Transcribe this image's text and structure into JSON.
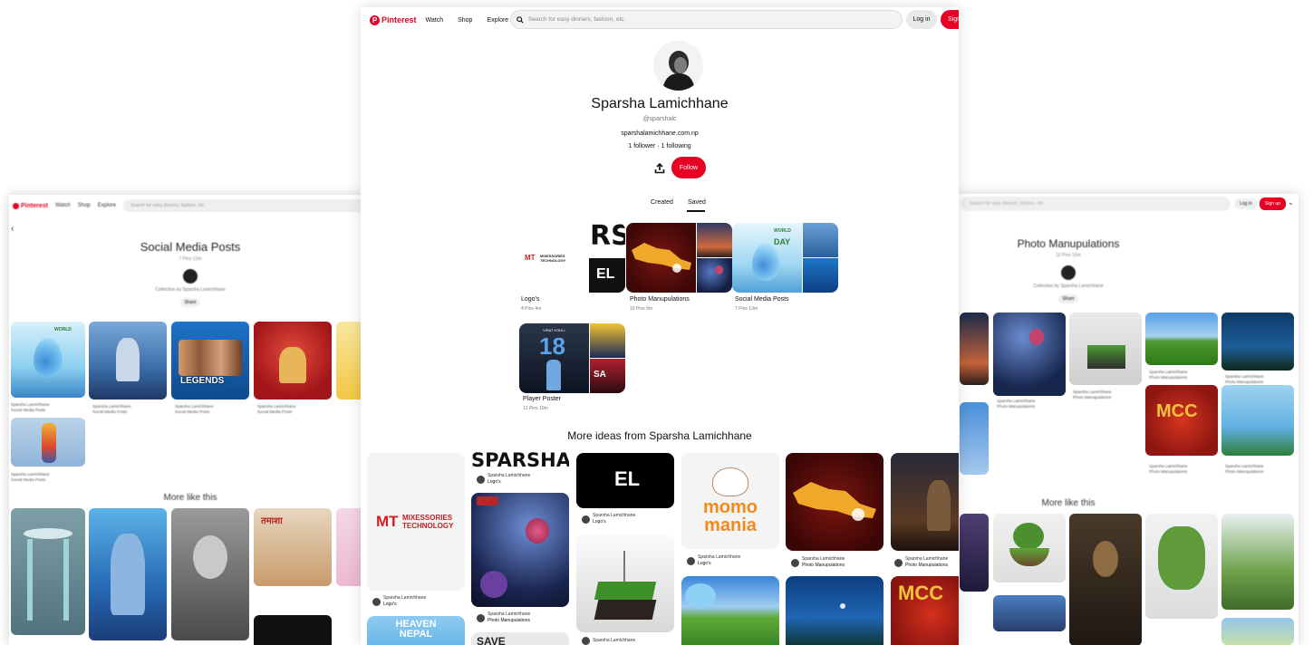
{
  "colors": {
    "brand_red": "#e60023",
    "text": "#111111",
    "muted": "#767676"
  },
  "nav": {
    "logo": "Pinterest",
    "links": [
      "Watch",
      "Shop",
      "Explore"
    ],
    "search_placeholder": "Search for easy dinners, fashion, etc.",
    "login": "Log in",
    "signup": "Sign up",
    "signup_visible": "Sign"
  },
  "profile": {
    "name": "Sparsha Lamichhane",
    "handle": "@sparshalc",
    "website": "sparshalamichhane.com.np",
    "stats": "1 follower · 1 following",
    "follow_label": "Follow",
    "share_icon": "share-upload-icon"
  },
  "tabs": {
    "created": "Created",
    "saved": "Saved",
    "active": "Saved"
  },
  "boards": [
    {
      "name": "Logo's",
      "meta": "4 Pins  4m"
    },
    {
      "name": "Photo Manupulations",
      "meta": "10 Pins  9m"
    },
    {
      "name": "Social Media Posts",
      "meta": "7 Pins  13m"
    },
    {
      "name": "Player Poster",
      "meta": "13 Pins  19m"
    }
  ],
  "board_art": {
    "mixessories_line1": "MIXESSORIES",
    "mixessories_line2": "TECHNOLOGY",
    "world_day": "WORLD",
    "day": "DAY",
    "player_number": "18",
    "player_name": "VIRAT KOHLI",
    "sas_text": "SA"
  },
  "more_ideas": {
    "title": "More ideas from Sparsha Lamichhane",
    "pins": [
      {
        "user": "Sparsha Lamichhane",
        "board": "Logo's"
      },
      {
        "user": "Sparsha Lamichhane",
        "board": "Logo's"
      },
      {
        "user": "Sparsha Lamichhane",
        "board": "Photo Manupulations"
      },
      {
        "user": "Sparsha Lamichhane",
        "board": "Logo's"
      },
      {
        "user": "Sparsha Lamichhane",
        "board": "Logo's"
      },
      {
        "user": "Sparsha Lamichhane",
        "board": "Photo Manupulations"
      },
      {
        "user": "Sparsha Lamichhane",
        "board": "Photo Manupulations"
      },
      {
        "user": "Sparsha Lamichhane",
        "board": ""
      }
    ],
    "sparsha_wordmark": "SPARSHA",
    "el_mark": "EL",
    "momo_line1": "momo",
    "momo_line2": "mania",
    "heaven_line1": "HEAVEN",
    "heaven_line2": "NEPAL",
    "mcc_text": "MCC",
    "save_text": "SAVE"
  },
  "left_panel": {
    "title": "Social Media Posts",
    "sub": "7 Pins  13m",
    "collection_by": "Collection by Sparsha Lamichhane",
    "share": "Share",
    "more_like": "More like this",
    "pin_user": "Sparsha Lamichhane",
    "pin_board": "Social Media Posts",
    "legends_text": "LEGENDS",
    "search_placeholder": "Search for easy dinners, fashion, etc."
  },
  "right_panel": {
    "title": "Photo Manupulations",
    "sub": "10 Pins  15m",
    "collection_by": "Collection by Sparsha Lamichhane",
    "share": "Share",
    "more_like": "More like this",
    "pin_user": "Sparsha Lamichhane",
    "pin_board": "Photo Manupulations",
    "login": "Log in",
    "signup": "Sign up",
    "mcc_text": "MCC",
    "search_placeholder": "Search for easy dinners, fashion, etc."
  }
}
